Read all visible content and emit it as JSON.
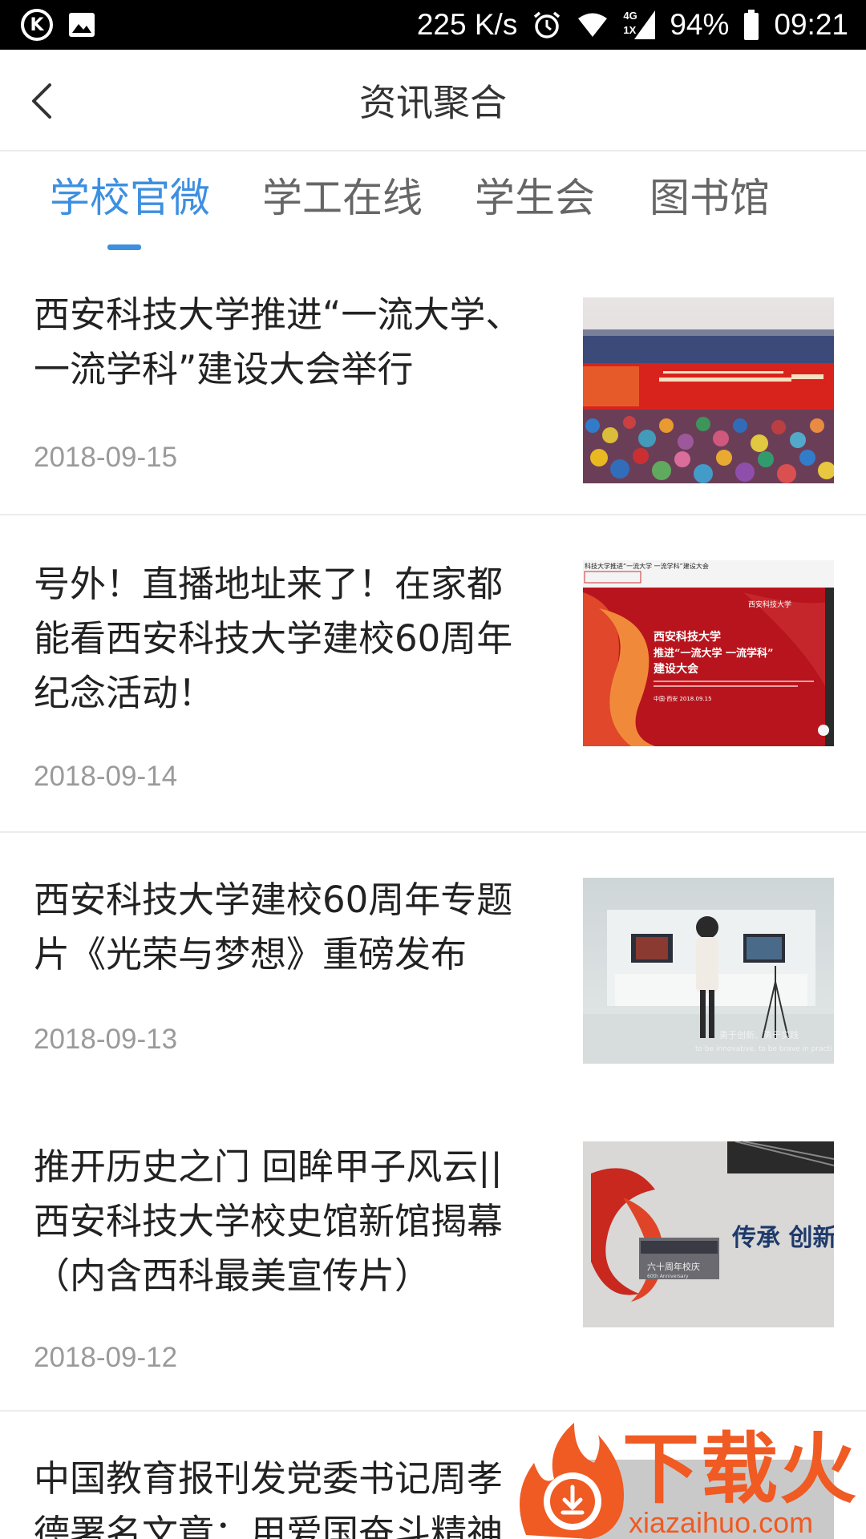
{
  "status_bar": {
    "net_speed": "225 K/s",
    "network": "4G",
    "network_sub": "1X",
    "battery": "94%",
    "time": "09:21",
    "icons": [
      "k-app-icon",
      "image-icon",
      "alarm-icon",
      "wifi-icon",
      "signal-icon",
      "battery-icon"
    ]
  },
  "header": {
    "title": "资讯聚合",
    "back_icon": "chevron-left-icon"
  },
  "tabs": [
    {
      "label": "学校官微",
      "active": true
    },
    {
      "label": "学工在线",
      "active": false
    },
    {
      "label": "学生会",
      "active": false
    },
    {
      "label": "图书馆",
      "active": false
    }
  ],
  "accent_color": "#3d8fe0",
  "news": [
    {
      "title_lines": [
        "西安科技大学推进“一流大学、",
        "一流学科”建设大会举行"
      ],
      "date": "2018-09-15",
      "thumb": "conference-crowd-photo"
    },
    {
      "title_lines": [
        "号外！直播地址来了！在家都",
        "能看西安科技大学建校60周年",
        "纪念活动！"
      ],
      "date": "2018-09-14",
      "thumb": "red-banner-screenshot",
      "thumb_text": {
        "top_bar": "科技大学推进“一流大学 一流学科”建设大会",
        "logo": "西安科技大学",
        "line1": "西安科技大学",
        "line2": "推进“一流大学 一流学科”",
        "line3": "建设大会",
        "footer": "中国·西安 2018.09.15"
      }
    },
    {
      "title_lines": [
        "西安科技大学建校60周年专题",
        "片《光荣与梦想》重磅发布"
      ],
      "date": "2018-09-13",
      "thumb": "vr-exhibition-photo",
      "thumb_text": {
        "subtitle_cn": "勇于创新、勇于实践",
        "subtitle_en": "to be innovative, to be brave in practi"
      }
    },
    {
      "title_lines": [
        "推开历史之门 回眸甲子风云||",
        "西安科技大学校史馆新馆揭幕",
        "（内含西科最美宣传片）"
      ],
      "date": "2018-09-12",
      "thumb": "history-museum-photo",
      "thumb_text": {
        "plaque": "六十周年校庆",
        "plaque_en": "60th Anniversary",
        "wall": "传承 创新"
      }
    },
    {
      "title_lines": [
        "中国教育报刊发党委书记周孝",
        "德署名文章：用爱国奋斗精神"
      ],
      "date": "",
      "thumb": "partial-photo"
    }
  ],
  "watermark": {
    "text": "下载火",
    "url": "xiazaihuo.com",
    "color": "#f05a23"
  }
}
